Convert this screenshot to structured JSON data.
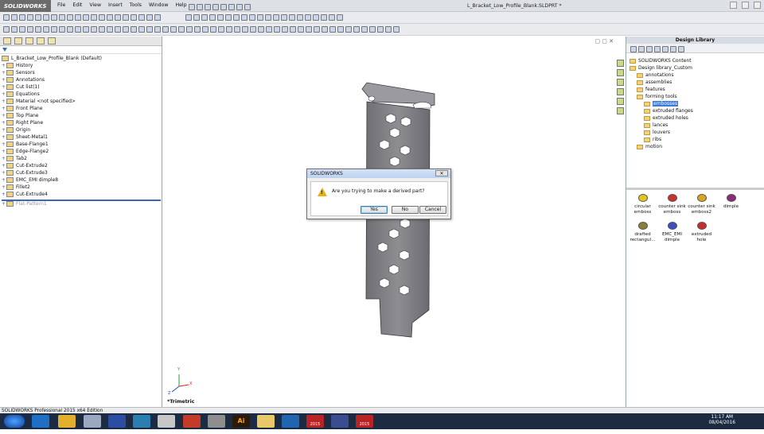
{
  "app": {
    "logo": "SOLIDWORKS",
    "doc_title": "L_Bracket_Low_Profile_Blank.SLDPRT *"
  },
  "menu": [
    "File",
    "Edit",
    "View",
    "Insert",
    "Tools",
    "Window",
    "Help"
  ],
  "tree": {
    "root": "L_Bracket_Low_Profile_Blank  (Default)",
    "items": [
      "History",
      "Sensors",
      "Annotations",
      "Cut list(1)",
      "Equations",
      "Material <not specified>",
      "Front Plane",
      "Top Plane",
      "Right Plane",
      "Origin",
      "Sheet-Metal1",
      "Base-Flange1",
      "Edge-Flange2",
      "Tab2",
      "Cut-Extrude2",
      "Cut-Extrude3",
      "EMC_EMI dimple8",
      "Fillet2",
      "Cut-Extrude4",
      "Flat-Pattern1"
    ]
  },
  "viewport": {
    "view_label": "*Trimetric",
    "axes": {
      "x": "X",
      "y": "Y",
      "z": "Z"
    }
  },
  "design_library": {
    "title": "Design Library",
    "tree": [
      "SOLIDWORKS Content",
      "Design library_Custom",
      "annotations",
      "assemblies",
      "features",
      "forming tools",
      "embosses",
      "extruded flanges",
      "extruded holes",
      "lances",
      "louvers",
      "ribs",
      "motion"
    ],
    "items": [
      "circular emboss",
      "counter sink emboss",
      "counter sink emboss2",
      "dimple",
      "drafted rectangul...",
      "EMC_EMI dimple",
      "extruded hole"
    ]
  },
  "dialog": {
    "title": "SOLIDWORKS",
    "close": "✕",
    "message": "Are you trying to make a derived part?",
    "yes": "Yes",
    "no": "No",
    "cancel": "Cancel"
  },
  "status": "SOLIDWORKS Professional 2015 x64 Edition",
  "taskbar": {
    "time": "11:17 AM",
    "date": "08/04/2016",
    "sw_label": "2015"
  },
  "colors": {
    "accent": "#3d7bd9",
    "taskbar": "#1c2a42",
    "warning": "#e7b10e"
  }
}
